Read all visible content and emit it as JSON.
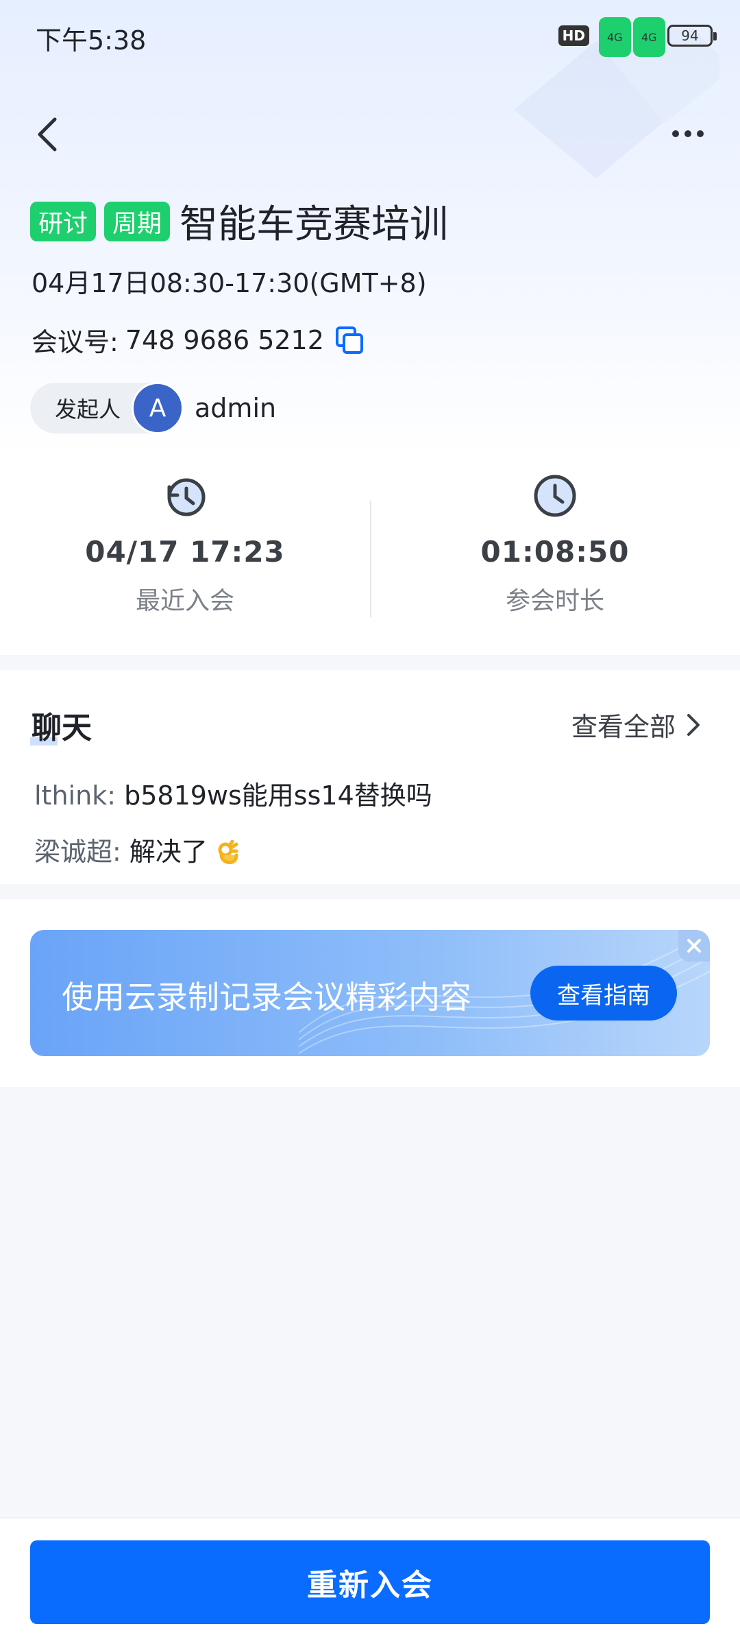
{
  "status_bar": {
    "time": "下午5:38",
    "hd_label": "HD",
    "network_1": "4G",
    "network_2": "4G",
    "battery": "94"
  },
  "meeting": {
    "tags": [
      "研讨",
      "周期"
    ],
    "title": "智能车竞赛培训",
    "time_range": "04月17日08:30-17:30(GMT+8)",
    "id_label": "会议号:",
    "id_value": "748 9686 5212",
    "host_label": "发起人",
    "host_avatar_letter": "A",
    "host_name": "admin"
  },
  "stats": {
    "last_join_value": "04/17 17:23",
    "last_join_label": "最近入会",
    "duration_value": "01:08:50",
    "duration_label": "参会时长"
  },
  "chat": {
    "title": "聊天",
    "view_all": "查看全部",
    "messages": [
      {
        "sender": "lthink:",
        "text": "b5819ws能用ss14替换吗"
      },
      {
        "sender": "梁诚超:",
        "text": "解决了"
      }
    ]
  },
  "banner": {
    "text": "使用云录制记录会议精彩内容",
    "button": "查看指南"
  },
  "bottom": {
    "rejoin": "重新入会"
  },
  "colors": {
    "primary": "#0a6cff",
    "tag_green": "#1ecf6e",
    "avatar_blue": "#3b64c8"
  }
}
